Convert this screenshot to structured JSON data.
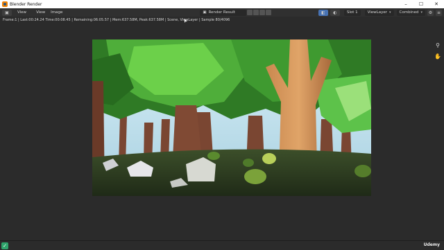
{
  "window": {
    "title": "Blender Render",
    "controls": [
      "–",
      "☐",
      "✕"
    ]
  },
  "toolbar": {
    "editor_icon": "image-editor-icon",
    "menus": [
      "View",
      "View",
      "Image"
    ],
    "image_name": "Render Result",
    "slot": "Slot 1",
    "view_layer": "ViewLayer",
    "pass": "Combined"
  },
  "status": {
    "text": "Frame:1 | Last:00:24.24 Time:00:08.45 | Remaining:06:05.57 | Mem:637.58M, Peak:637.58M | Scene, ViewLayer | Sample 80/4096"
  },
  "watermark": "Udemy",
  "colors": {
    "sky": "#bfe0ee",
    "foliage": "#4aa63a",
    "trunk": "#7a4a34",
    "ground": "#2f3f22"
  }
}
